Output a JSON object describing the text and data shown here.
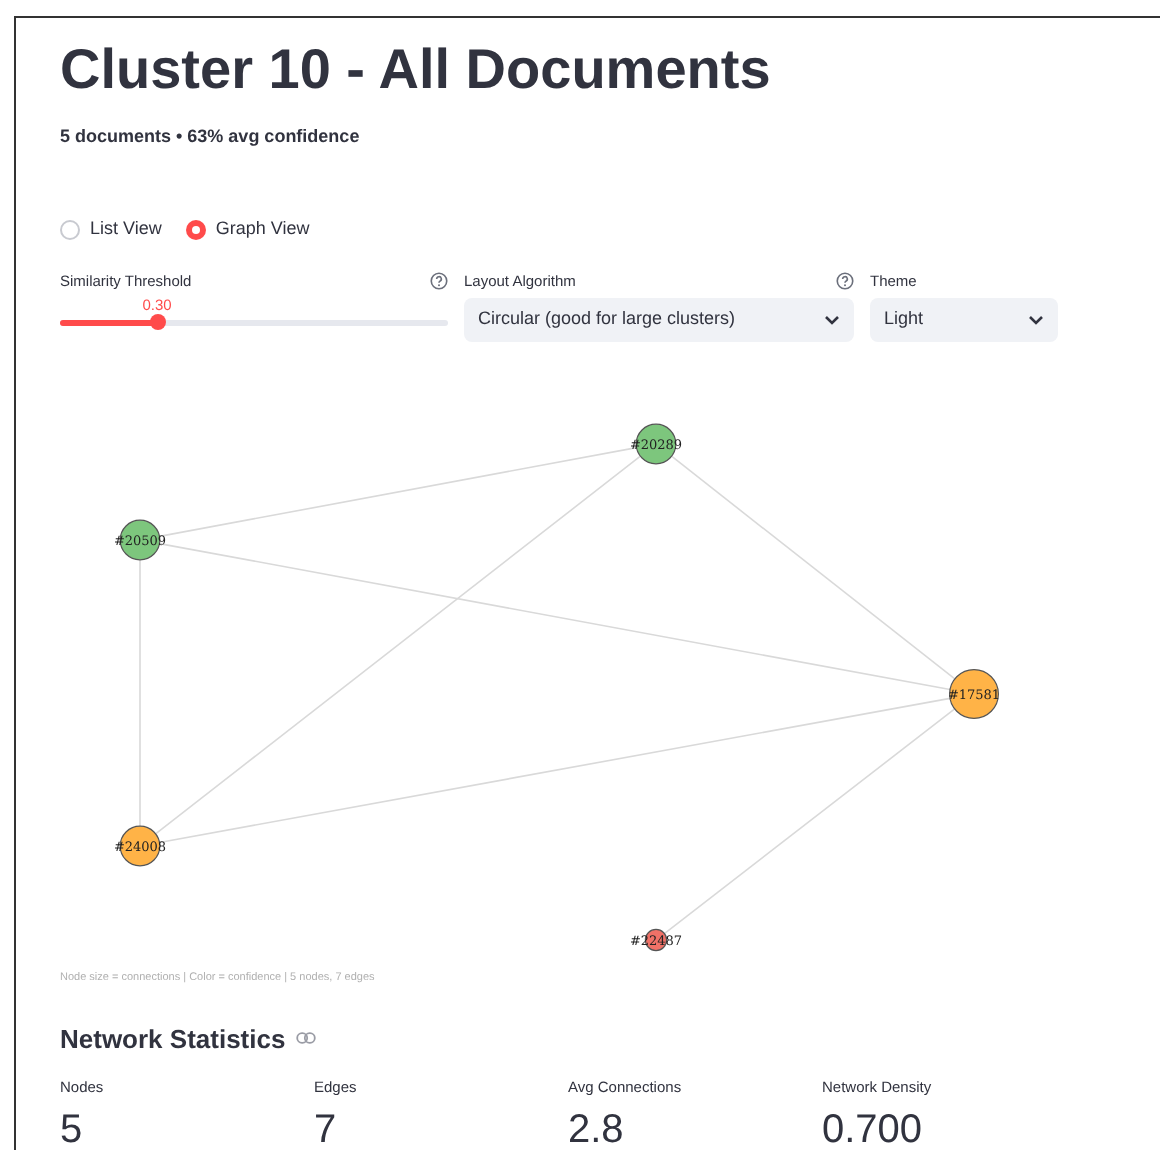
{
  "title": "Cluster 10 - All Documents",
  "subtitle": "5 documents • 63% avg confidence",
  "view_options": [
    {
      "label": "List View",
      "selected": false
    },
    {
      "label": "Graph View",
      "selected": true
    }
  ],
  "similarity_threshold": {
    "label": "Similarity Threshold",
    "reading": "0.30",
    "level": 0.25
  },
  "layout_algorithm": {
    "label": "Layout Algorithm",
    "value": "Circular (good for large clusters)"
  },
  "theme": {
    "label": "Theme",
    "value": "Light"
  },
  "graph": {
    "nodes": [
      {
        "label": "#20289",
        "color": "#7dc67d"
      },
      {
        "label": "#20509",
        "color": "#7dc67d"
      },
      {
        "label": "#17581",
        "color": "#ffb347"
      },
      {
        "label": "#24008",
        "color": "#ffb347"
      },
      {
        "label": "#22487",
        "color": "#f07167"
      }
    ],
    "caption": "Node size = connections | Color = confidence | 5 nodes, 7 edges"
  },
  "network_statistics": {
    "heading": "Network Statistics",
    "metrics": [
      {
        "label": "Nodes",
        "value": "5"
      },
      {
        "label": "Edges",
        "value": "7"
      },
      {
        "label": "Avg Connections",
        "value": "2.8"
      },
      {
        "label": "Network Density",
        "value": "0.700"
      }
    ]
  }
}
